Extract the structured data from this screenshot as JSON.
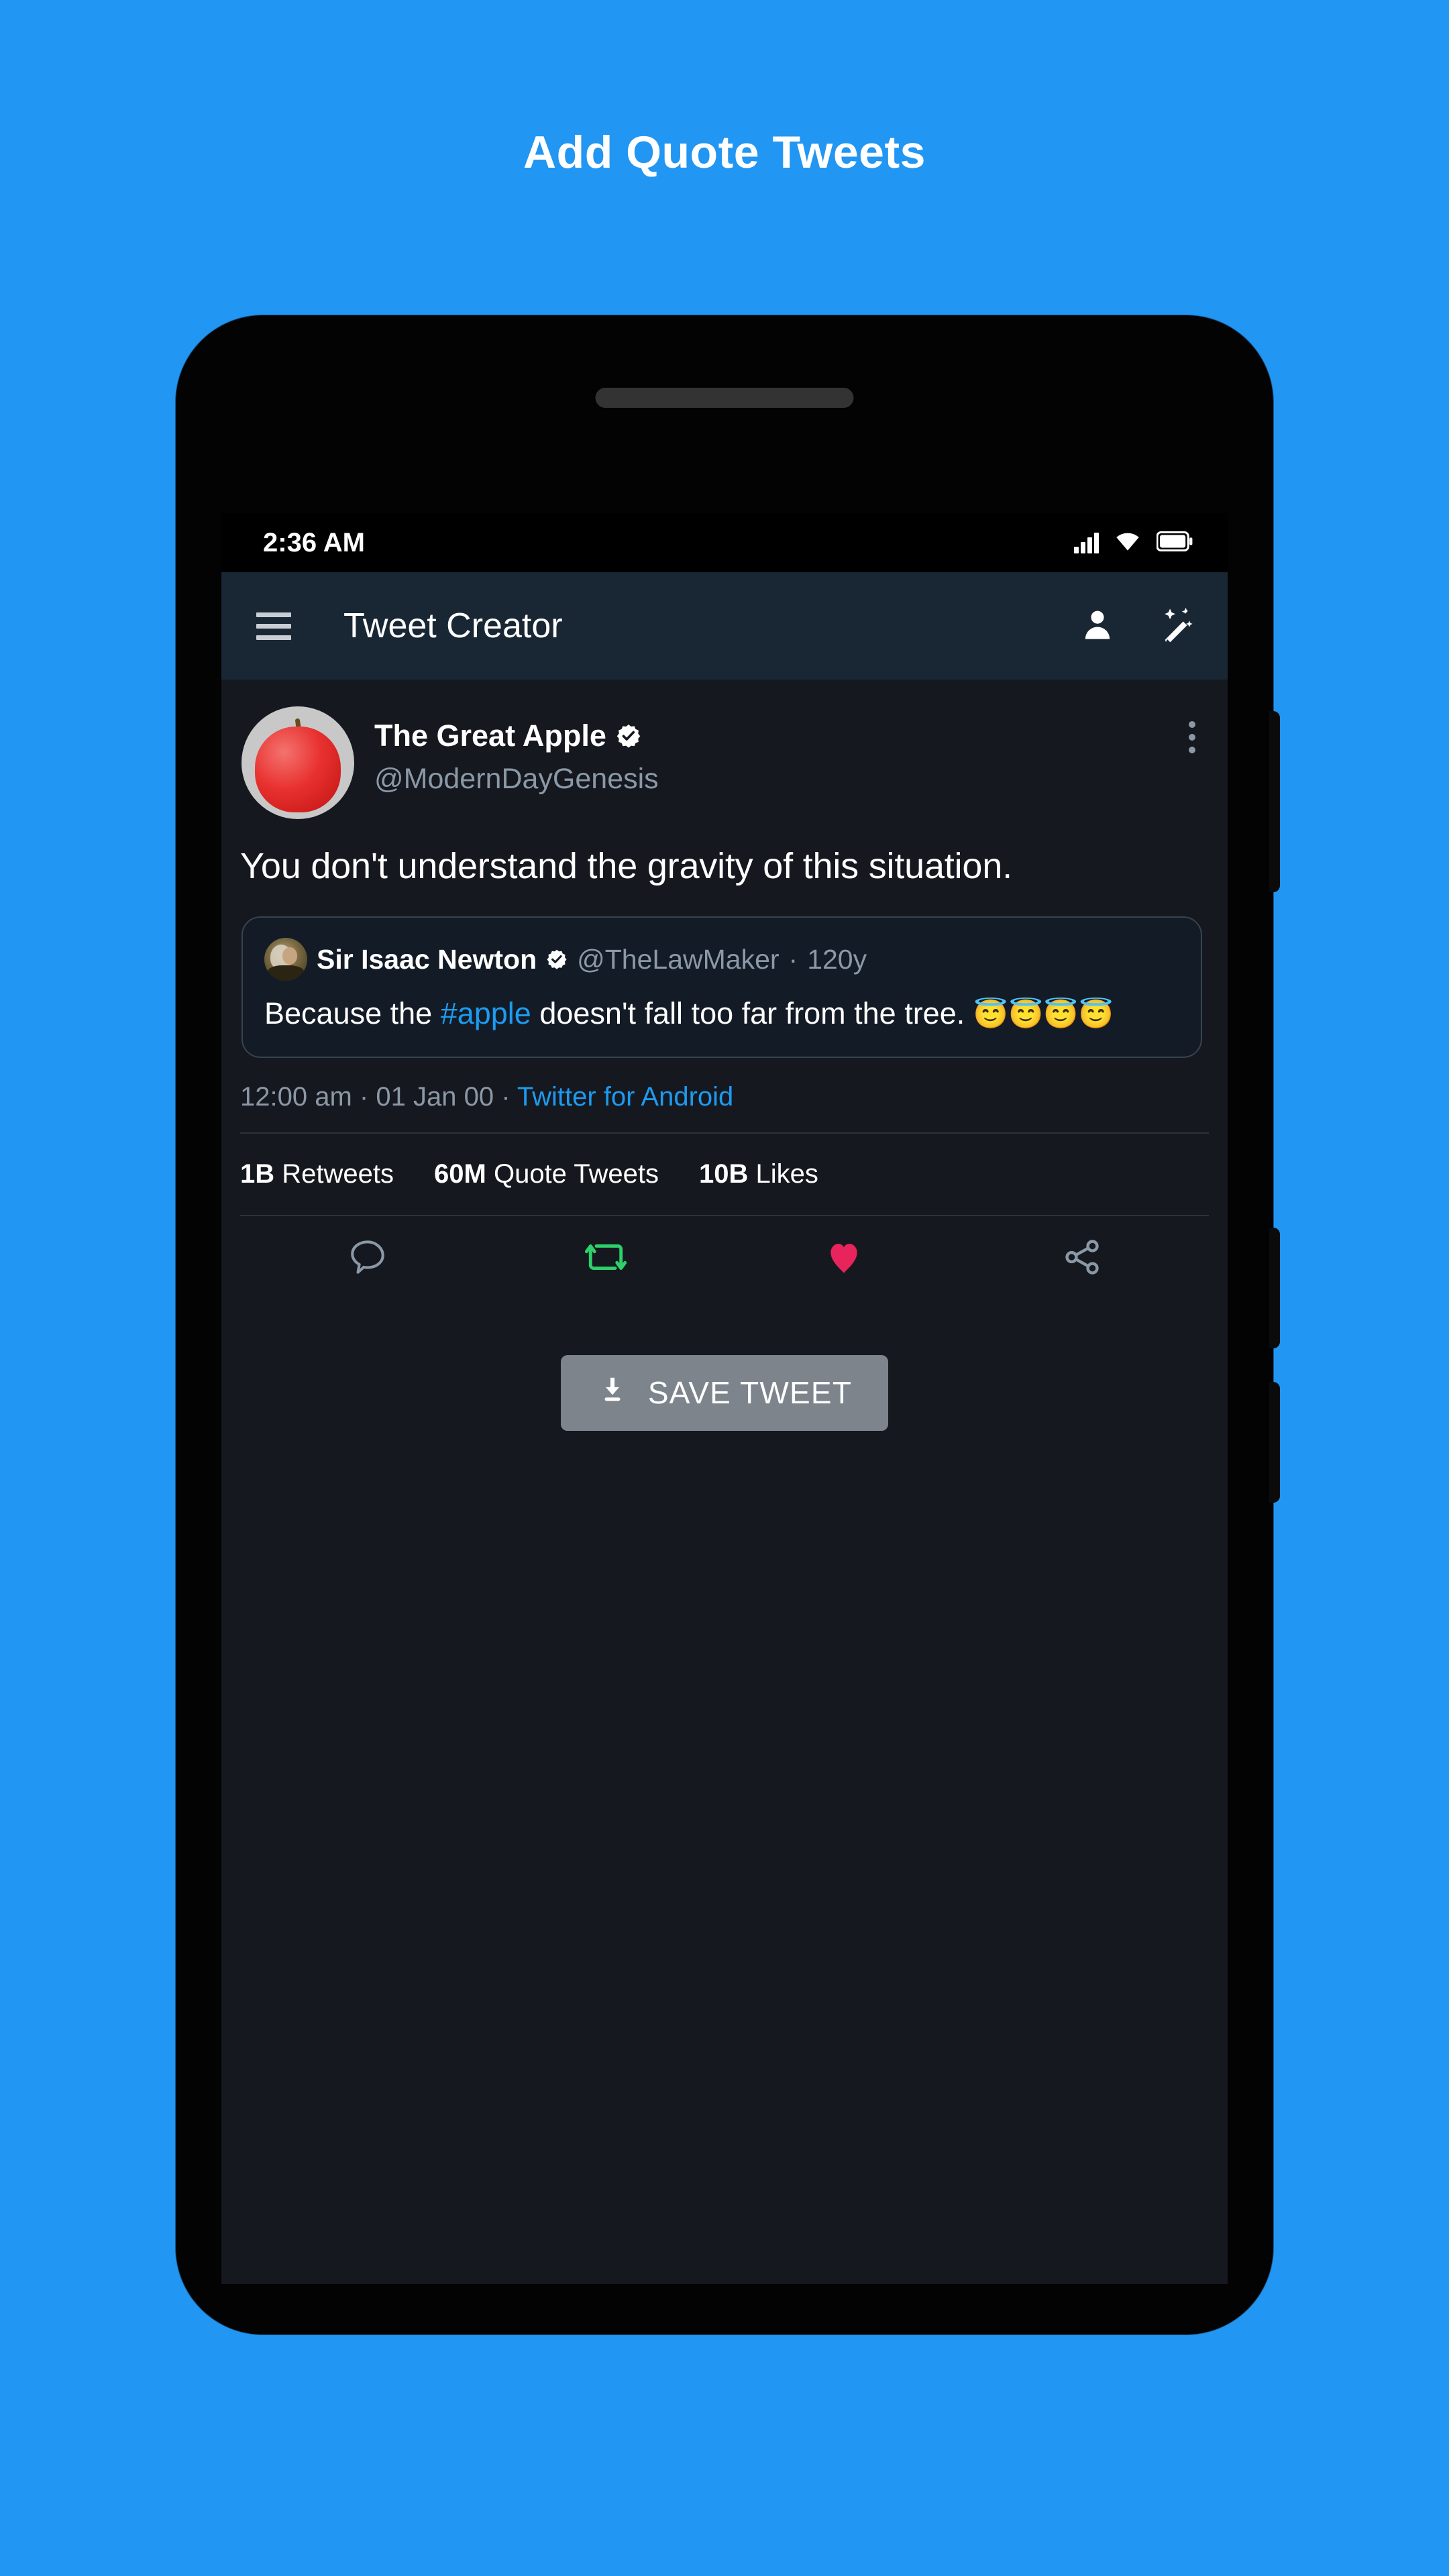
{
  "headline": "Add Quote Tweets",
  "status_bar": {
    "time": "2:36 AM",
    "signal_icon": "cellular-signal-icon",
    "wifi_icon": "wifi-icon",
    "battery_icon": "battery-full-icon"
  },
  "app_bar": {
    "menu_icon": "hamburger-menu-icon",
    "title": "Tweet Creator",
    "profile_icon": "person-icon",
    "magic_icon": "auto-fix-magic-wand-icon"
  },
  "tweet": {
    "author": {
      "display_name": "The Great Apple",
      "handle": "@ModernDayGenesis",
      "verified": true,
      "avatar": "red-apple-photo"
    },
    "more_icon": "more-vertical-icon",
    "text": "You don't understand the gravity of this situation.",
    "quote": {
      "display_name": "Sir Isaac Newton",
      "verified": true,
      "handle": "@TheLawMaker",
      "separator": "·",
      "age": "120y",
      "avatar": "isaac-newton-portrait",
      "text_before": "Because the ",
      "hashtag": "#apple",
      "text_after": " doesn't fall too far from the tree. ",
      "emojis": "😇😇😇😇"
    },
    "meta": {
      "time": "12:00 am",
      "dot1": "·",
      "date": "01 Jan 00",
      "dot2": "·",
      "source": "Twitter for Android"
    },
    "stats": [
      {
        "value": "1B",
        "label": "Retweets"
      },
      {
        "value": "60M",
        "label": "Quote Tweets"
      },
      {
        "value": "10B",
        "label": "Likes"
      }
    ],
    "actions": [
      {
        "name": "reply-icon",
        "color": "#8b98a5"
      },
      {
        "name": "retweet-icon",
        "color": "#2dd16a"
      },
      {
        "name": "like-heart-icon",
        "color": "#e8245c"
      },
      {
        "name": "share-icon",
        "color": "#8b98a5"
      }
    ]
  },
  "save_button": {
    "label": "SAVE TWEET",
    "icon": "download-icon"
  },
  "colors": {
    "page_background": "#2196F3",
    "screen_background": "#15181f",
    "appbar_background": "#192734",
    "link_blue": "#1d9bf0",
    "muted_text": "#8b98a5",
    "retweet_green": "#2dd16a",
    "like_pink": "#e8245c",
    "save_button_gray": "#7e848c"
  }
}
